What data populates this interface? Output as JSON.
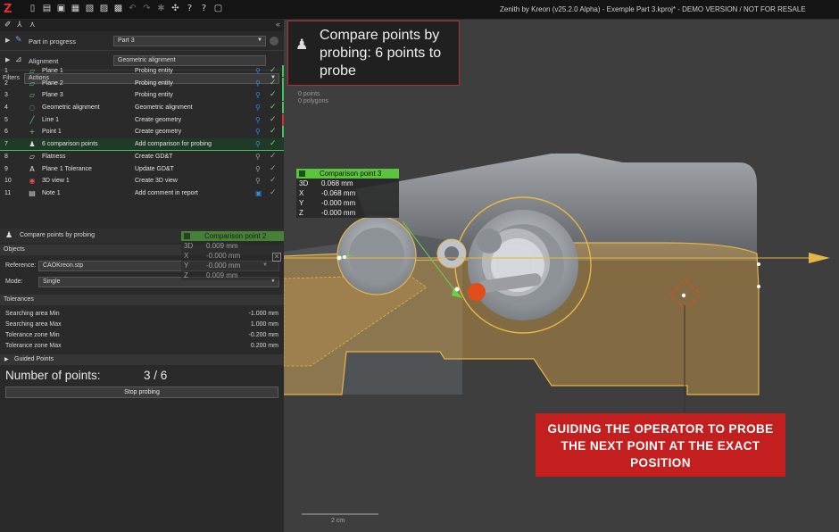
{
  "app": {
    "title": "Zenith by Kreon (v25.2.0 Alpha) - Exemple Part 3.kproj* - DEMO VERSION / NOT FOR RESALE",
    "logo": "Z"
  },
  "toolbar_icons": [
    "new-icon",
    "open-icon",
    "save-icon",
    "save-as-icon",
    "import-icon",
    "export-icon",
    "image-icon",
    "undo-icon",
    "redo-icon",
    "settings-icon",
    "scan-icon",
    "help-icon",
    "info-icon",
    "fullscreen-icon"
  ],
  "panel": {
    "collapse_label": "«",
    "part_label": "Part in progress",
    "part_value": "Part 3",
    "alignment_label": "Alignment",
    "alignment_value": "Geometric alignment",
    "filters_label": "Filters",
    "filters_value": "Actions"
  },
  "steps": [
    {
      "num": "1",
      "name": "Plane 1",
      "action": "Probing entity",
      "icon": "plane-icon",
      "status": "done",
      "bar": "#3ec45a"
    },
    {
      "num": "2",
      "name": "Plane 2",
      "action": "Probing entity",
      "icon": "plane-icon",
      "status": "done",
      "bar": "#3ec45a"
    },
    {
      "num": "3",
      "name": "Plane 3",
      "action": "Probing entity",
      "icon": "plane-icon",
      "status": "done",
      "bar": "#3ec45a"
    },
    {
      "num": "4",
      "name": "Geometric alignment",
      "action": "Geometric alignment",
      "icon": "alignment-icon",
      "status": "done",
      "bar": "#3ec45a"
    },
    {
      "num": "5",
      "name": "Line 1",
      "action": "Create geometry",
      "icon": "line-icon",
      "status": "done",
      "bar": "#d03030"
    },
    {
      "num": "6",
      "name": "Point 1",
      "action": "Create geometry",
      "icon": "point-icon",
      "status": "done",
      "bar": "#3ec45a"
    },
    {
      "num": "7",
      "name": "6 comparison points",
      "action": "Add comparison for probing",
      "icon": "comparison-icon",
      "status": "current",
      "bar": ""
    },
    {
      "num": "8",
      "name": "Flatness",
      "action": "Create GD&T",
      "icon": "flatness-icon",
      "status": "pending",
      "bar": ""
    },
    {
      "num": "9",
      "name": "Plane 1 Tolerance",
      "action": "Update GD&T",
      "icon": "tolerance-icon",
      "status": "pending",
      "bar": ""
    },
    {
      "num": "10",
      "name": "3D view 1",
      "action": "Create 3D view",
      "icon": "view-icon",
      "status": "pending",
      "bar": ""
    },
    {
      "num": "11",
      "name": "Note 1",
      "action": "Add comment in report",
      "icon": "note-icon",
      "status": "pending",
      "bar": ""
    }
  ],
  "compare": {
    "title": "Compare points by probing",
    "objects_label": "Objects",
    "reference_label": "Reference:",
    "reference_value": "CAOKreon.stp",
    "mode_label": "Mode:",
    "mode_value": "Single",
    "tolerances_label": "Tolerances",
    "tolerances": [
      {
        "label": "Searching area Min",
        "value": "-1.000 mm"
      },
      {
        "label": "Searching area Max",
        "value": "1.000 mm"
      },
      {
        "label": "Tolerance zone Min",
        "value": "-0.200 mm"
      },
      {
        "label": "Tolerance zone Max",
        "value": "0.200 mm"
      }
    ],
    "guided_label": "Guided Points",
    "npoints_label": "Number of points:",
    "npoints_value": "3 / 6",
    "stop_label": "Stop probing"
  },
  "viewport": {
    "stats_points": "0 points",
    "stats_polygons": "0 polygons",
    "scale_label": "2 cm"
  },
  "hint": {
    "text": "Compare points by probing: 6 points to probe"
  },
  "cp3": {
    "title": "Comparison point 3",
    "rows": [
      {
        "k": "3D",
        "v": "0.068 mm"
      },
      {
        "k": "X",
        "v": "-0.068 mm"
      },
      {
        "k": "Y",
        "v": "-0.000 mm"
      },
      {
        "k": "Z",
        "v": "-0.000 mm"
      }
    ]
  },
  "cp2": {
    "title": "Comparison point 2",
    "close": "✕",
    "rows": [
      {
        "k": "3D",
        "v": "0.009 mm"
      },
      {
        "k": "X",
        "v": "-0.000 mm"
      },
      {
        "k": "Y",
        "v": "-0.000 mm"
      },
      {
        "k": "Z",
        "v": "0.009 mm"
      }
    ]
  },
  "callout": {
    "text": "GUIDING THE OPERATOR TO PROBE THE NEXT POINT AT THE EXACT POSITION"
  }
}
